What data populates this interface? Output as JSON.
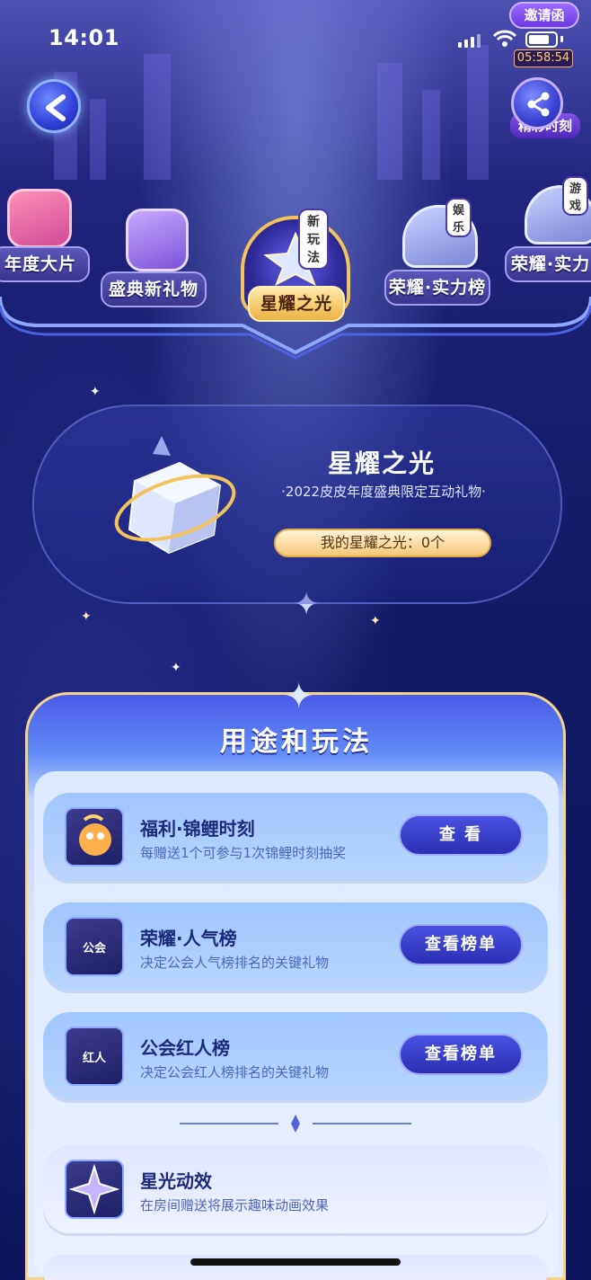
{
  "status_bar": {
    "time": "14:01"
  },
  "top_right": {
    "invite_label": "邀请函",
    "timer": "05:58:54",
    "share_tag": "精彩时刻"
  },
  "tabs": [
    {
      "label": "年度大片"
    },
    {
      "label": "盛典新礼物"
    },
    {
      "label": "星耀之光",
      "badge": "新玩法"
    },
    {
      "label": "荣耀·实力榜",
      "badge": "娱乐"
    },
    {
      "label": "荣耀·实力",
      "badge": "游戏"
    }
  ],
  "hero": {
    "title": "星耀之光",
    "subtitle": "·2022皮皮年度盛典限定互动礼物·",
    "count_label": "我的星耀之光：0个"
  },
  "panel": {
    "heading": "用途和玩法",
    "rows": [
      {
        "title": "福利·锦鲤时刻",
        "desc": "每赠送1个可参与1次锦鲤时刻抽奖",
        "button": "查 看",
        "icon": "koi-icon"
      },
      {
        "title": "荣耀·人气榜",
        "desc": "决定公会人气榜排名的关键礼物",
        "button": "查看榜单",
        "icon_text": "公会"
      },
      {
        "title": "公会红人榜",
        "desc": "决定公会红人榜排名的关键礼物",
        "button": "查看榜单",
        "icon_text": "红人"
      },
      {
        "title": "星光动效",
        "desc": "在房间赠送将展示趣味动画效果",
        "icon": "sparkle-icon"
      }
    ]
  },
  "colors": {
    "accent": "#2b2fb3",
    "gold": "#f0b244",
    "bg": "#141b6a"
  }
}
